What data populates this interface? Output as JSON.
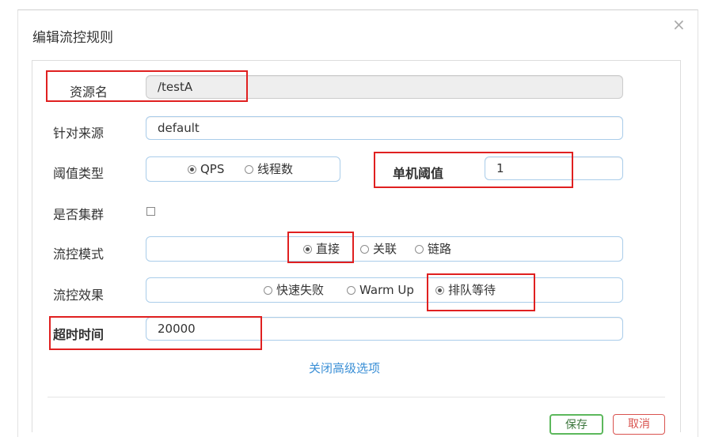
{
  "dialog": {
    "title": "编辑流控规则",
    "close_icon": "×"
  },
  "form": {
    "resource_name_label": "资源名",
    "resource_name_value": "/testA",
    "limit_app_label": "针对来源",
    "limit_app_value": "default",
    "grade_label": "阈值类型",
    "grade_options": [
      "QPS",
      "线程数"
    ],
    "threshold_label": "单机阈值",
    "threshold_value": "1",
    "cluster_label": "是否集群",
    "strategy_label": "流控模式",
    "strategy_options": [
      "直接",
      "关联",
      "链路"
    ],
    "control_behavior_label": "流控效果",
    "control_behavior_options": [
      "快速失败",
      "Warm Up",
      "排队等待"
    ],
    "timeout_label": "超时时间",
    "timeout_value": "20000",
    "toggle_advanced_link": "关闭高级选项"
  },
  "buttons": {
    "save_label": "保存",
    "cancel_label": "取消"
  },
  "colors": {
    "annotation_red": "#e02020",
    "link_blue": "#3a8fd6",
    "save_green": "#5cb85c",
    "cancel_red": "#d9534f"
  }
}
